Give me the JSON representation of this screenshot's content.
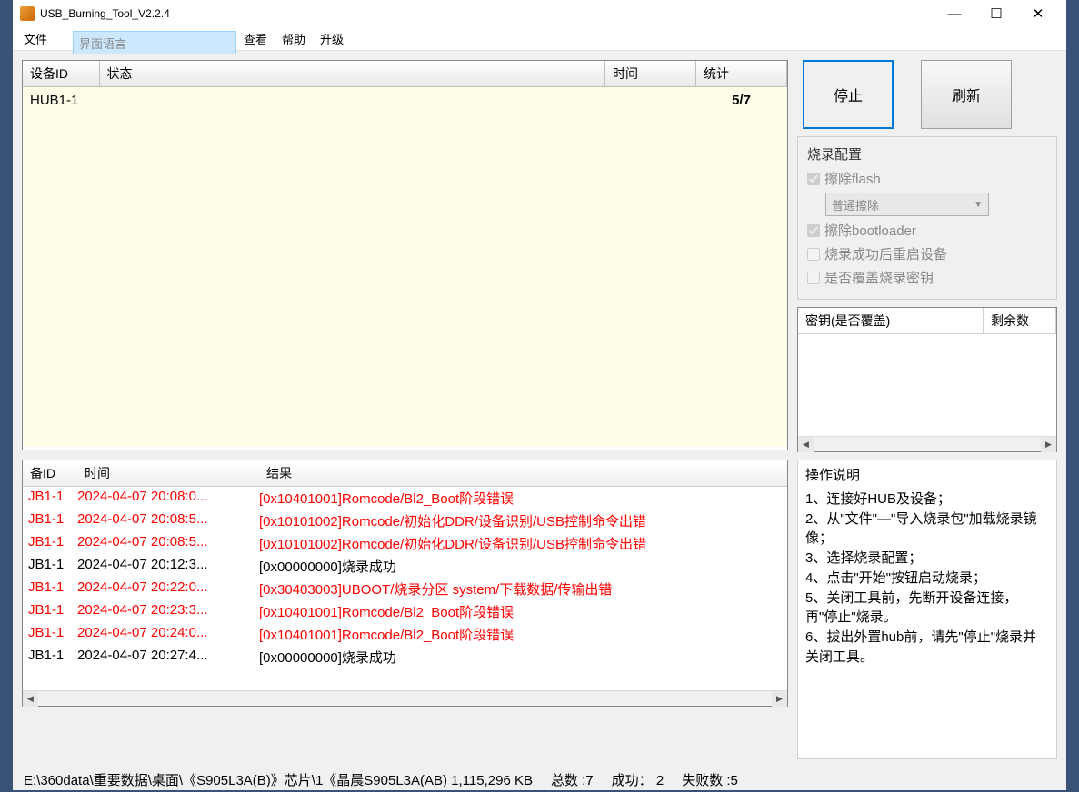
{
  "window": {
    "title": "USB_Burning_Tool_V2.2.4",
    "controls": {
      "min": "—",
      "max": "☐",
      "close": "✕"
    }
  },
  "menu": [
    "文件",
    "界面语言",
    "查看",
    "帮助",
    "升级"
  ],
  "device_table": {
    "headers": [
      "设备ID",
      "状态",
      "时间",
      "统计"
    ],
    "row": {
      "id": "HUB1-1",
      "status": "",
      "time": "",
      "stat": "5/7"
    }
  },
  "buttons": {
    "stop": "停止",
    "refresh": "刷新"
  },
  "config": {
    "title": "烧录配置",
    "erase_flash": "擦除flash",
    "erase_mode": "普通擦除",
    "erase_bootloader": "擦除bootloader",
    "reboot": "烧录成功后重启设备",
    "overwrite_key": "是否覆盖烧录密钥"
  },
  "key_table": {
    "h1": "密钥(是否覆盖)",
    "h2": "剩余数"
  },
  "instructions": {
    "title": "操作说明",
    "lines": [
      "1、连接好HUB及设备；",
      "2、从\"文件\"—\"导入烧录包\"加载烧录镜像；",
      "3、选择烧录配置；",
      "4、点击\"开始\"按钮启动烧录；",
      "5、关闭工具前，先断开设备连接，再\"停止\"烧录。",
      "6、拔出外置hub前，请先\"停止\"烧录并关闭工具。"
    ]
  },
  "log": {
    "headers": [
      "备ID",
      "时间",
      "结果"
    ],
    "rows": [
      {
        "id": "JB1-1",
        "time": "2024-04-07 20:08:0...",
        "result": "[0x10401001]Romcode/Bl2_Boot阶段错误",
        "err": true
      },
      {
        "id": "JB1-1",
        "time": "2024-04-07 20:08:5...",
        "result": "[0x10101002]Romcode/初始化DDR/设备识别/USB控制命令出错",
        "err": true
      },
      {
        "id": "JB1-1",
        "time": "2024-04-07 20:08:5...",
        "result": "[0x10101002]Romcode/初始化DDR/设备识别/USB控制命令出错",
        "err": true
      },
      {
        "id": "JB1-1",
        "time": "2024-04-07 20:12:3...",
        "result": "[0x00000000]烧录成功",
        "err": false
      },
      {
        "id": "JB1-1",
        "time": "2024-04-07 20:22:0...",
        "result": "[0x30403003]UBOOT/烧录分区 system/下载数据/传输出错",
        "err": true
      },
      {
        "id": "JB1-1",
        "time": "2024-04-07 20:23:3...",
        "result": "[0x10401001]Romcode/Bl2_Boot阶段错误",
        "err": true
      },
      {
        "id": "JB1-1",
        "time": "2024-04-07 20:24:0...",
        "result": "[0x10401001]Romcode/Bl2_Boot阶段错误",
        "err": true
      },
      {
        "id": "JB1-1",
        "time": "2024-04-07 20:27:4...",
        "result": "[0x00000000]烧录成功",
        "err": false
      }
    ]
  },
  "statusbar": {
    "path": "E:\\360data\\重要数据\\桌面\\《S905L3A(B)》芯片\\1《晶晨S905L3A(AB) 1,115,296 KB",
    "total_label": "总数 :",
    "total": "7",
    "success_label": "成功：",
    "success": "2",
    "fail_label": "失败数 :",
    "fail": "5"
  }
}
